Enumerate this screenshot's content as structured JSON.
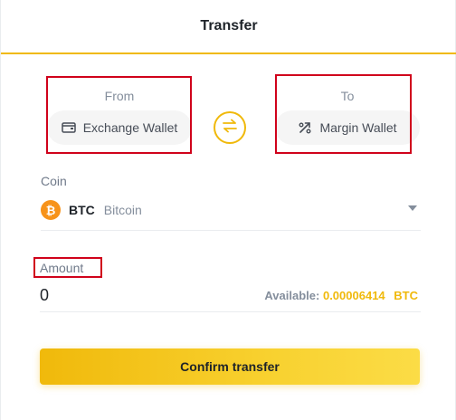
{
  "header": {
    "title": "Transfer"
  },
  "from": {
    "label": "From",
    "wallet": "Exchange Wallet",
    "icon": "wallet-icon"
  },
  "to": {
    "label": "To",
    "wallet": "Margin Wallet",
    "icon": "margin-icon"
  },
  "swap": {
    "icon": "swap-arrows-icon"
  },
  "coin": {
    "label": "Coin",
    "symbol": "BTC",
    "name": "Bitcoin",
    "icon_glyph": "₿"
  },
  "amount": {
    "label": "Amount",
    "value": "0",
    "available_prefix": "Available:",
    "available_value": "0.00006414",
    "available_unit": "BTC"
  },
  "confirm": {
    "label": "Confirm transfer"
  },
  "colors": {
    "accent": "#f0b90b",
    "highlight": "#d0021b",
    "bitcoin": "#f7931a"
  }
}
